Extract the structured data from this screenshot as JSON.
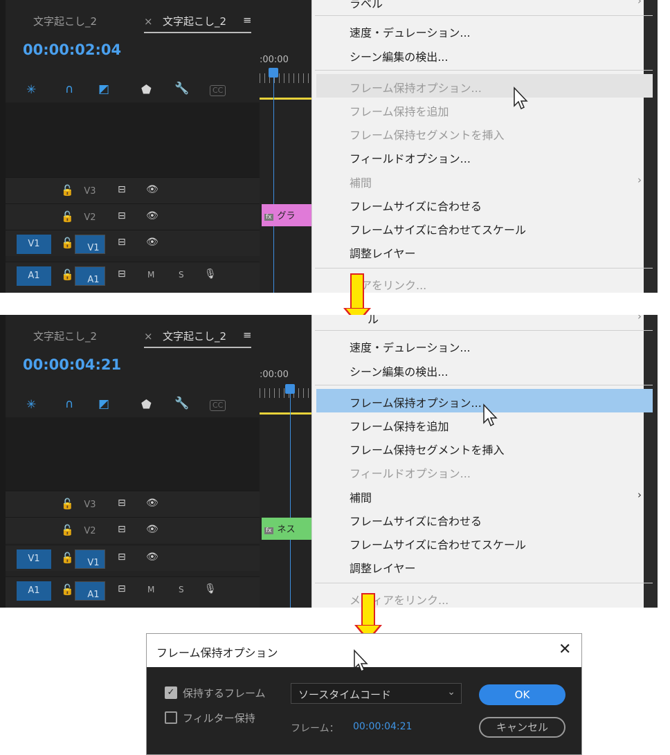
{
  "panels": [
    {
      "tab_left": "文字起こし_2",
      "tab_close": "×",
      "tab_active": "文字起こし_2",
      "tab_menu": "≡",
      "timecode": "00:00:02:04",
      "ruler_label": ":00:00",
      "tracks": [
        {
          "label": "V3",
          "src": ""
        },
        {
          "label": "V2",
          "src": ""
        },
        {
          "label": "V1",
          "src": "V1"
        },
        {
          "label": "A1",
          "src": "A1",
          "audio": true
        }
      ],
      "track_m": "M",
      "track_s": "S",
      "clip_label": "グラ",
      "clip_color": "#e07ad8",
      "menu": {
        "top_fragment": "ラベル",
        "items": [
          {
            "label": "速度・デュレーション...",
            "disabled": false
          },
          {
            "label": "シーン編集の検出...",
            "disabled": false
          },
          {
            "label": "フレーム保持オプション...",
            "disabled": true,
            "hover": true
          },
          {
            "label": "フレーム保持を追加",
            "disabled": true
          },
          {
            "label": "フレーム保持セグメントを挿入",
            "disabled": true
          },
          {
            "label": "フィールドオプション...",
            "disabled": false
          },
          {
            "label": "補間",
            "disabled": true,
            "submenu": true
          },
          {
            "label": "フレームサイズに合わせる",
            "disabled": false
          },
          {
            "label": "フレームサイズに合わせてスケール",
            "disabled": false
          },
          {
            "label": "調整レイヤー",
            "disabled": false
          }
        ],
        "bottom_fragment": "ィアをリンク..."
      }
    },
    {
      "tab_left": "文字起こし_2",
      "tab_close": "×",
      "tab_active": "文字起こし_2",
      "tab_menu": "≡",
      "timecode": "00:00:04:21",
      "ruler_label": ":00:00",
      "tracks": [
        {
          "label": "V3",
          "src": ""
        },
        {
          "label": "V2",
          "src": ""
        },
        {
          "label": "V1",
          "src": "V1"
        },
        {
          "label": "A1",
          "src": "A1",
          "audio": true
        }
      ],
      "track_m": "M",
      "track_s": "S",
      "clip_label": "ネス",
      "clip_color": "#6fcf6f",
      "menu": {
        "top_fragment": "ル",
        "items": [
          {
            "label": "速度・デュレーション...",
            "disabled": false
          },
          {
            "label": "シーン編集の検出...",
            "disabled": false
          },
          {
            "label": "フレーム保持オプション...",
            "disabled": false,
            "selected": true
          },
          {
            "label": "フレーム保持を追加",
            "disabled": false
          },
          {
            "label": "フレーム保持セグメントを挿入",
            "disabled": false
          },
          {
            "label": "フィールドオプション...",
            "disabled": true
          },
          {
            "label": "補間",
            "disabled": false,
            "submenu": true
          },
          {
            "label": "フレームサイズに合わせる",
            "disabled": false
          },
          {
            "label": "フレームサイズに合わせてスケール",
            "disabled": false
          },
          {
            "label": "調整レイヤー",
            "disabled": false
          }
        ],
        "bottom_fragment": "メ　ィアをリンク..."
      }
    }
  ],
  "dialog": {
    "title": "フレーム保持オプション",
    "close": "✕",
    "hold_frame_label": "保持するフレーム",
    "hold_frame_checked": true,
    "filter_label": "フィルター保持",
    "filter_checked": false,
    "select_value": "ソースタイムコード",
    "frame_label": "フレーム：",
    "frame_value": "00:00:04:21",
    "ok": "OK",
    "cancel": "キャンセル"
  },
  "colors": {
    "accent": "#2f86e6",
    "timecode": "#4aa0ee",
    "menu_selected": "#9ec9ef",
    "arrow_fill": "#ffe600",
    "arrow_border": "#e02020"
  }
}
